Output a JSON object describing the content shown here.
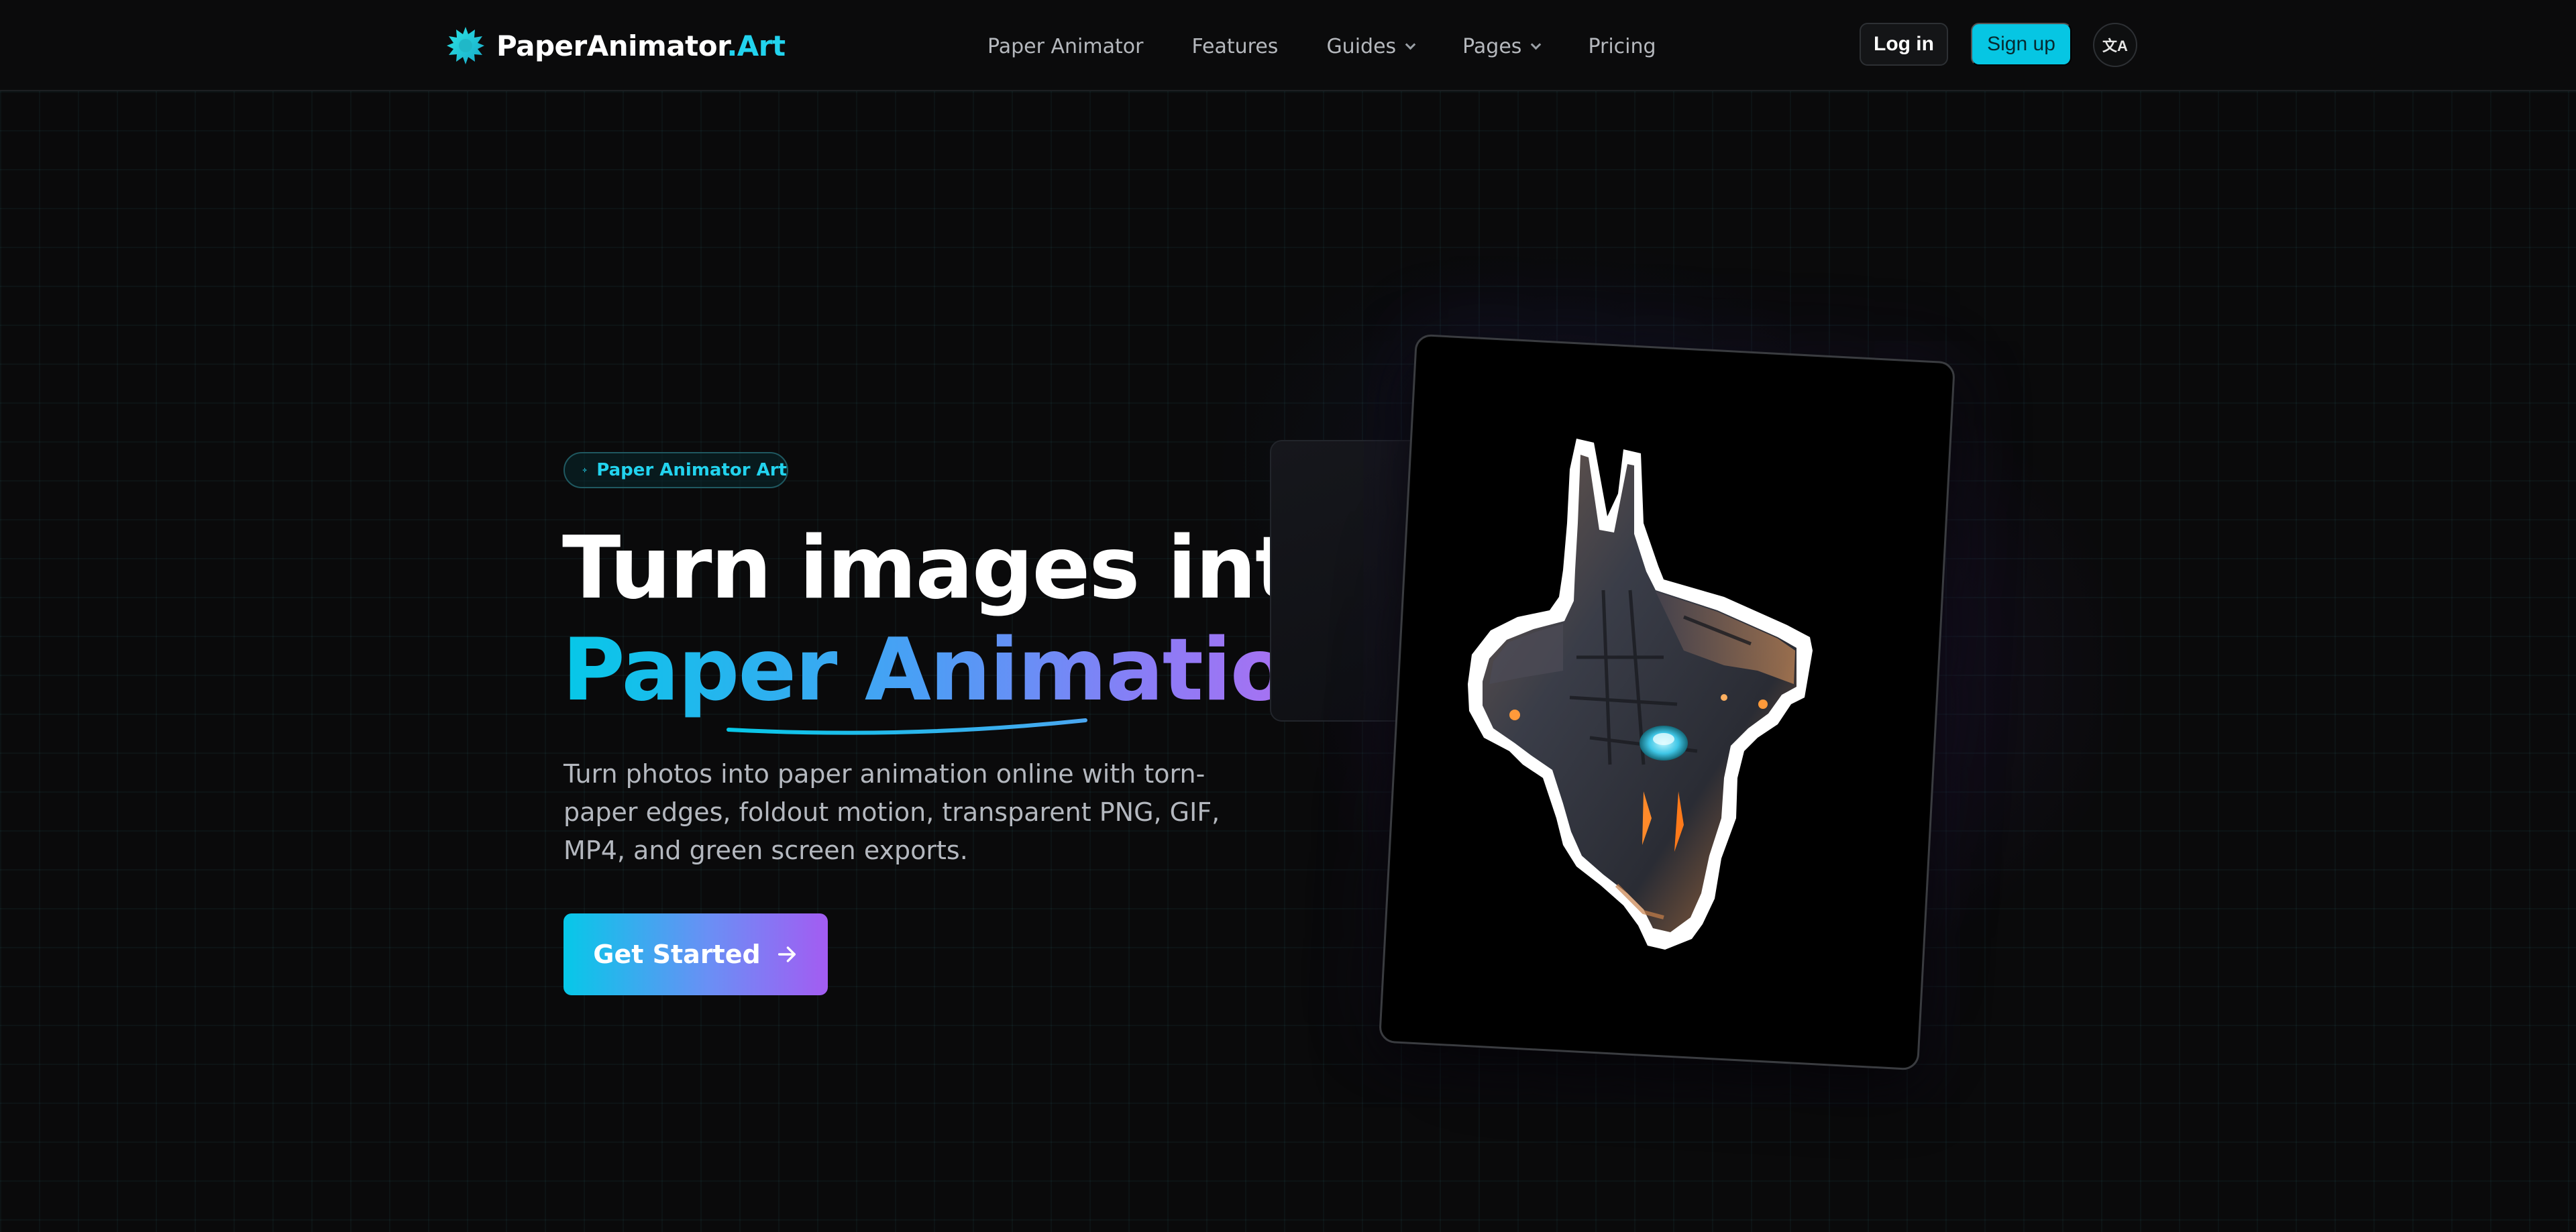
{
  "brand": {
    "name_main": "PaperAnimator",
    "name_accent": ".Art",
    "accent_color": "#22d3ee",
    "logo_icon": "sunburst-logo-icon"
  },
  "nav": {
    "links": [
      {
        "label": "Paper Animator",
        "has_dropdown": false
      },
      {
        "label": "Features",
        "has_dropdown": false
      },
      {
        "label": "Guides",
        "has_dropdown": true
      },
      {
        "label": "Pages",
        "has_dropdown": true
      },
      {
        "label": "Pricing",
        "has_dropdown": false
      }
    ],
    "login_label": "Log in",
    "signup_label": "Sign up",
    "language_icon": "translate-icon",
    "language_glyph": "文A"
  },
  "hero": {
    "badge_label": "Paper Animator Art",
    "badge_icon": "sparkle-icon",
    "title_line1": "Turn images into",
    "title_line2": "Paper Animation",
    "subtitle": "Turn photos into paper animation online with torn-paper edges, foldout motion, transparent PNG, GIF, MP4, and green screen exports.",
    "cta_label": "Get Started",
    "cta_icon": "arrow-right-icon",
    "gradient_colors": [
      "#06c8e8",
      "#4a9ff5",
      "#8b7cf6",
      "#b56cf0"
    ]
  },
  "preview": {
    "image_subject": "spaceship-sticker",
    "background_color": "#000000"
  }
}
